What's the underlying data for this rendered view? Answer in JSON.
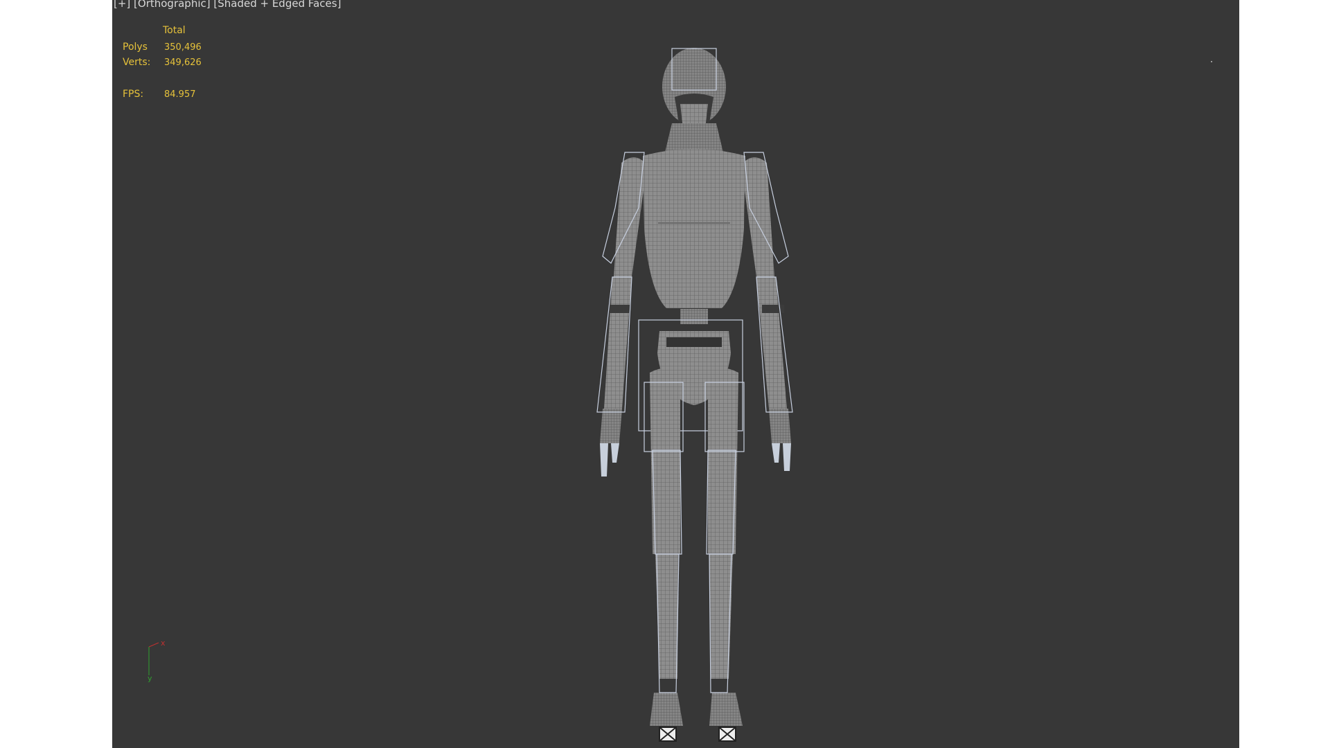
{
  "viewport": {
    "label": "[+] [Orthographic] [Shaded + Edged Faces]"
  },
  "stats": {
    "header": "Total",
    "polys_label": "Polys",
    "polys_value": "350,496",
    "verts_label": "Verts:",
    "verts_value": "349,626",
    "fps_label": "FPS:",
    "fps_value": "84.957"
  },
  "axis_gizmo": {
    "x_label": "x",
    "y_label": "y",
    "x_color": "#c03030",
    "y_color": "#2fa02f"
  },
  "colors": {
    "viewport_bg": "#373737",
    "stats_text": "#e6c23a",
    "mesh_fill": "#8c8c8c",
    "mesh_wire": "#5a5a5a",
    "bone_lines": "#c8d0e0"
  },
  "model": {
    "name_icon": "humanoid-robot-mesh"
  }
}
